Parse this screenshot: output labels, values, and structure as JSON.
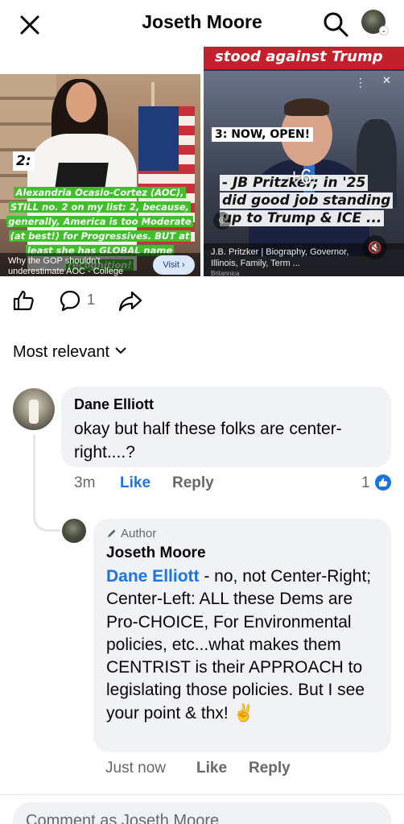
{
  "header": {
    "title": "Joseth Moore",
    "close_icon": "close-icon",
    "search_icon": "search-icon"
  },
  "carousel": {
    "left_card": {
      "number": "2:",
      "caption": "Alexandria Ocasio-Cortez (AOC), STILL no. 2 on my list: 2, because, generally, America is too Moderate (at best!) for Progressives. BUT at least she has GLOBAL name recognition!",
      "footer_text": "Why the GOP shouldn't underestimate AOC - College",
      "visit_label": "Visit ›"
    },
    "right_card": {
      "banner": "stood against Trump",
      "number": "3: NOW, OPEN!",
      "caption": "- JB Pritzker; in '25 did good job standing up to Trump & ICE ...",
      "more_count": "+6",
      "footer_text": "J.B. Pritzker | Biography, Governor, Illinois, Family, Term ...",
      "footer_source": "Britannica"
    },
    "accent_green": "#3fbf2a"
  },
  "actions": {
    "comment_count": "1"
  },
  "sort_label": "Most relevant",
  "comments": [
    {
      "author": "Dane Elliott",
      "text": "okay but half these folks are center-right....?",
      "time": "3m",
      "like_label": "Like",
      "reply_label": "Reply",
      "reaction_count": "1"
    }
  ],
  "reply": {
    "badge": "Author",
    "author": "Joseth Moore",
    "mention": "Dane Elliott",
    "text": " -  no, not Center-Right; Center-Left:  ALL these Dems are Pro-CHOICE, For Environmental policies, etc...what makes them CENTRIST is their APPROACH to legislating those policies.  But I see your point & thx! ✌",
    "time": "Just now",
    "like_label": "Like",
    "reply_label": "Reply"
  },
  "composer": {
    "placeholder": "Comment as Joseth Moore"
  },
  "colors": {
    "link_blue": "#1b74e4",
    "bubble_bg": "#f0f2f5",
    "muted_text": "#65676b"
  }
}
